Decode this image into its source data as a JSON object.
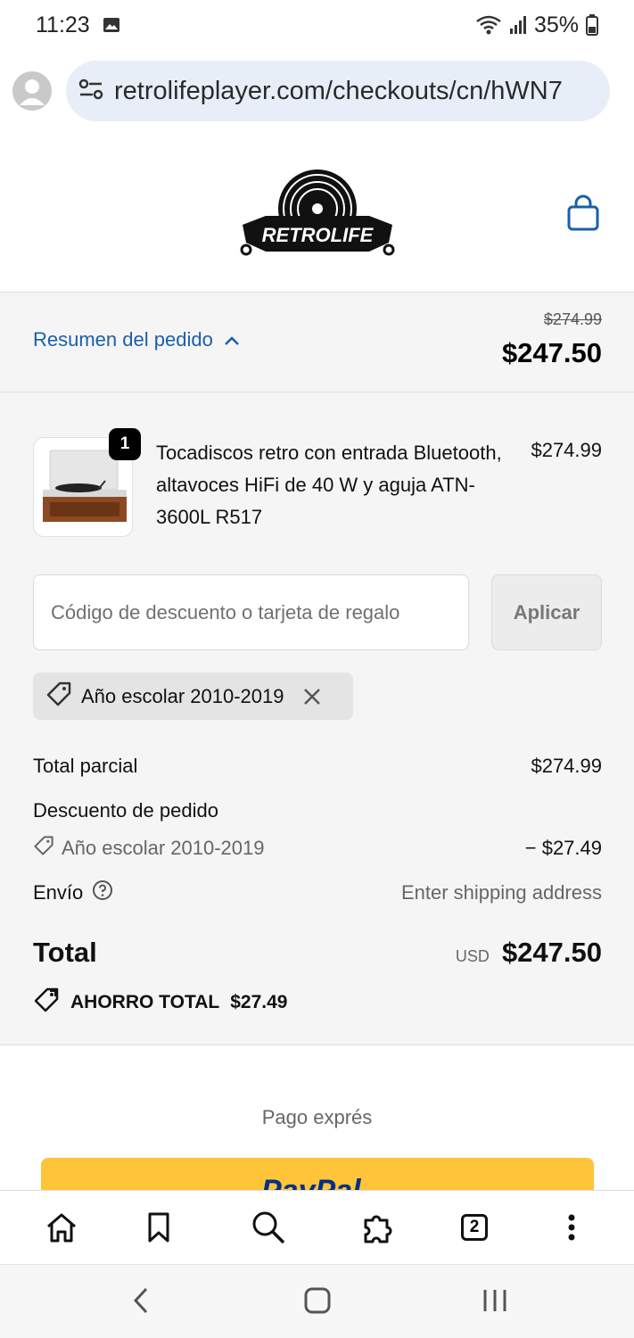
{
  "status_bar": {
    "time": "11:23",
    "battery": "35%"
  },
  "browser": {
    "url": "retrolifeplayer.com/checkouts/cn/hWN7"
  },
  "header": {
    "logo_text": "RETROLIFE"
  },
  "summary": {
    "toggle_label": "Resumen del pedido",
    "original_price": "$274.99",
    "total": "$247.50"
  },
  "product": {
    "quantity": "1",
    "name": "Tocadiscos retro con entrada Bluetooth, altavoces HiFi de 40 W y aguja ATN-3600L R517",
    "price": "$274.99"
  },
  "discount": {
    "placeholder": "Código de descuento o tarjeta de regalo",
    "apply_label": "Aplicar",
    "applied_code": "Año escolar 2010-2019"
  },
  "totals": {
    "subtotal_label": "Total parcial",
    "subtotal_value": "$274.99",
    "order_discount_label": "Descuento de pedido",
    "order_discount_code": "Año escolar 2010-2019",
    "order_discount_value": "− $27.49",
    "shipping_label": "Envío",
    "shipping_value": "Enter shipping address",
    "total_label": "Total",
    "currency": "USD",
    "total_value": "$247.50",
    "savings_label": "AHORRO TOTAL",
    "savings_value": "$27.49"
  },
  "express": {
    "label": "Pago exprés",
    "paypal_label": "PayPal"
  },
  "browser_nav": {
    "tab_count": "2"
  },
  "colors": {
    "link": "#1a5fa8",
    "paypal": "#ffc439",
    "paypal_text": "#003087"
  }
}
